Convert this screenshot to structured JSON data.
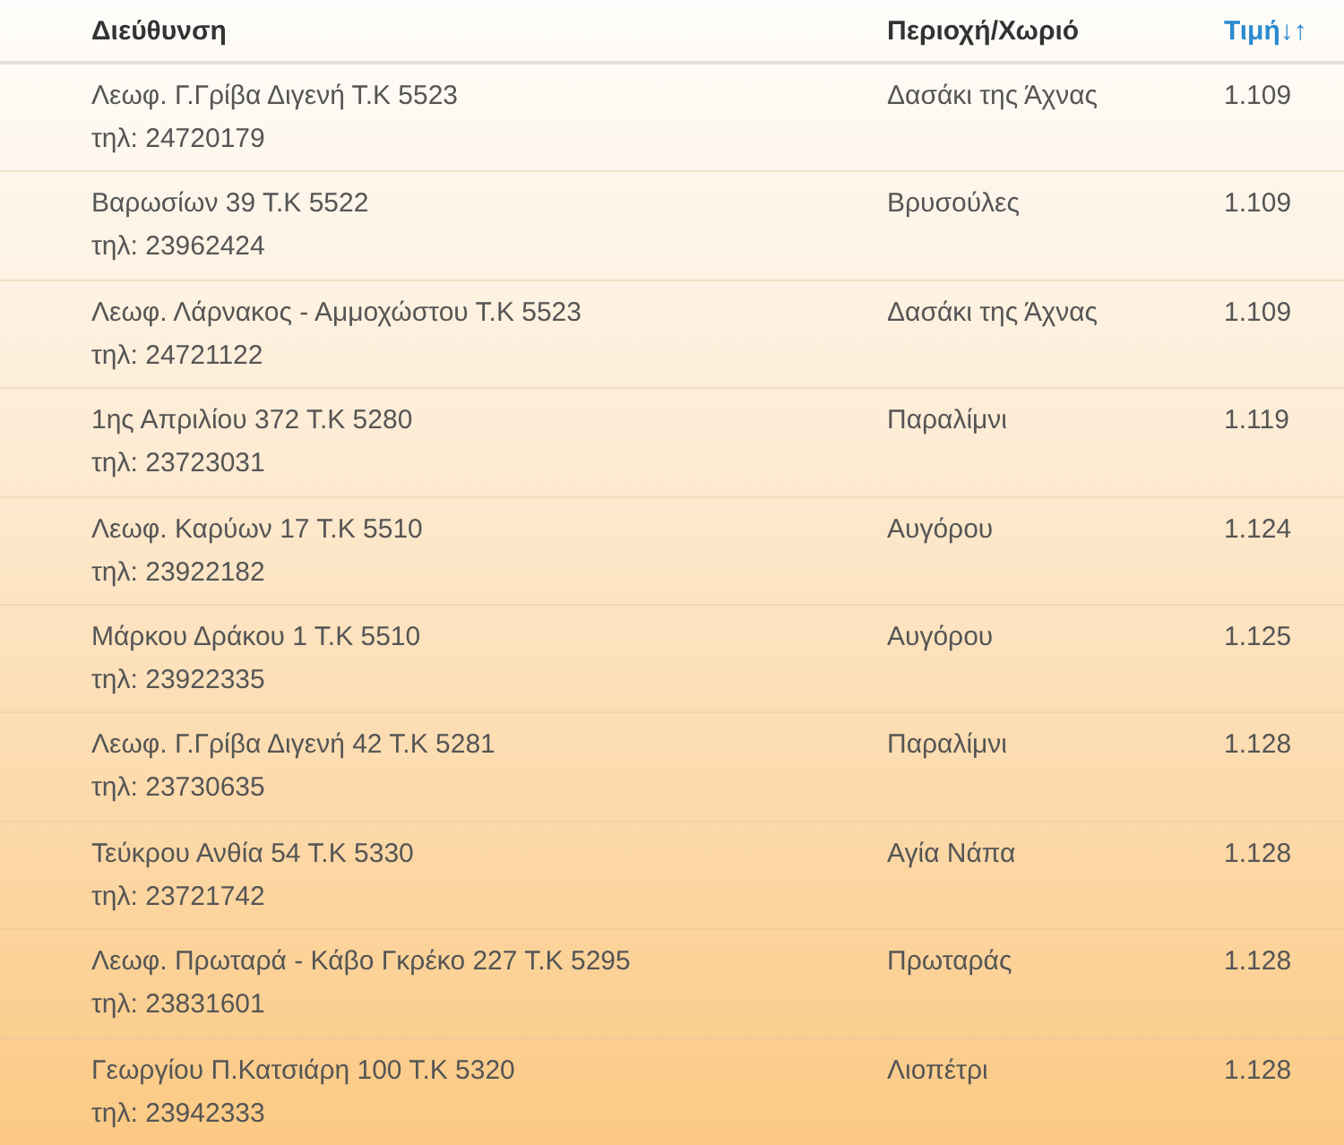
{
  "table": {
    "columns": [
      {
        "label": "Διεύθυνση",
        "selected": false
      },
      {
        "label": "Περιοχή/Χωριό",
        "selected": false
      },
      {
        "label": "Τιμή",
        "selected": true,
        "sort_icon": "↓↑"
      }
    ],
    "rows": [
      {
        "address": "Λεωφ. Γ.Γρίβα Διγενή Τ.Κ 5523",
        "phone": "τηλ: 24720179",
        "area": "Δασάκι της Άχνας",
        "price": "1.109"
      },
      {
        "address": "Βαρωσίων 39 Τ.Κ 5522",
        "phone": "τηλ: 23962424",
        "area": "Βρυσούλες",
        "price": "1.109"
      },
      {
        "address": "Λεωφ. Λάρνακος - Αμμοχώστου Τ.Κ 5523",
        "phone": "τηλ: 24721122",
        "area": "Δασάκι της Άχνας",
        "price": "1.109"
      },
      {
        "address": "1ης Απριλίου 372 Τ.Κ 5280",
        "phone": "τηλ: 23723031",
        "area": "Παραλίμνι",
        "price": "1.119"
      },
      {
        "address": "Λεωφ. Καρύων 17 Τ.Κ 5510",
        "phone": "τηλ: 23922182",
        "area": "Αυγόρου",
        "price": "1.124"
      },
      {
        "address": "Μάρκου Δράκου 1 Τ.Κ 5510",
        "phone": "τηλ: 23922335",
        "area": "Αυγόρου",
        "price": "1.125"
      },
      {
        "address": "Λεωφ. Γ.Γρίβα Διγενή 42 Τ.Κ 5281",
        "phone": "τηλ: 23730635",
        "area": "Παραλίμνι",
        "price": "1.128"
      },
      {
        "address": "Τεύκρου Ανθία 54 Τ.Κ 5330",
        "phone": "τηλ: 23721742",
        "area": "Αγία Νάπα",
        "price": "1.128"
      },
      {
        "address": "Λεωφ. Πρωταρά - Κάβο Γκρέκο 227 Τ.Κ 5295",
        "phone": "τηλ: 23831601",
        "area": "Πρωταράς",
        "price": "1.128"
      },
      {
        "address": "Γεωργίου Π.Κατσιάρη 100 Τ.Κ 5320",
        "phone": "τηλ: 23942333",
        "area": "Λιοπέτρι",
        "price": "1.128"
      }
    ]
  }
}
